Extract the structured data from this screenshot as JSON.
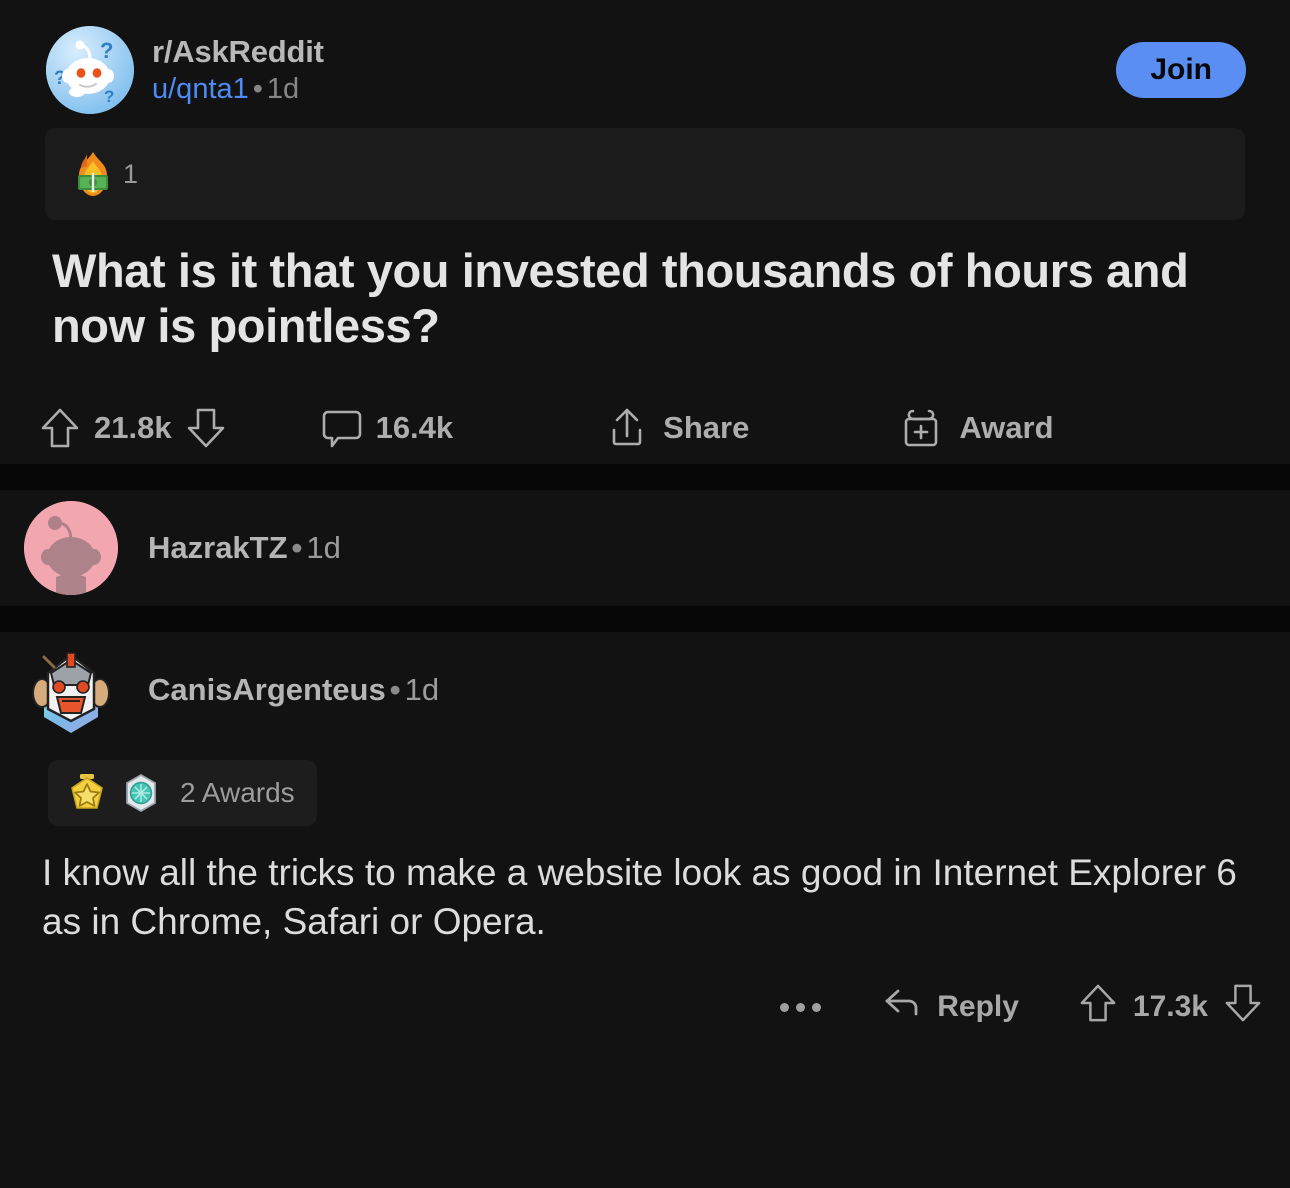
{
  "post": {
    "subreddit": "r/AskReddit",
    "author": "u/qnta1",
    "separator": "•",
    "age": "1d",
    "join_label": "Join",
    "award_icon": "burning-money-award-icon",
    "award_count": "1",
    "title": "What is it that you invested thousands of hours and now is pointless?",
    "actions": {
      "upvote_icon": "upvote-arrow-icon",
      "score": "21.8k",
      "downvote_icon": "downvote-arrow-icon",
      "comment_icon": "comment-bubble-icon",
      "comment_count": "16.4k",
      "share_icon": "share-icon",
      "share_label": "Share",
      "award_icon": "gift-award-icon",
      "award_label": "Award"
    }
  },
  "comments": [
    {
      "avatar_icon": "snoo-avatar-pink-icon",
      "author": "HazrakTZ",
      "separator": "•",
      "age": "1d"
    },
    {
      "avatar_icon": "mecha-avatar-icon",
      "author": "CanisArgenteus",
      "separator": "•",
      "age": "1d",
      "awards": {
        "badges": [
          "gold-star-badge-icon",
          "teal-gem-badge-icon"
        ],
        "label": "2 Awards"
      },
      "body": "I know all the tricks to make a website look as good in Internet Explorer 6 as in Chrome, Safari or Opera.",
      "footer": {
        "overflow_icon": "overflow-menu-icon",
        "reply_icon": "reply-arrow-icon",
        "reply_label": "Reply",
        "upvote_icon": "upvote-arrow-icon",
        "score": "17.3k",
        "downvote_icon": "downvote-arrow-icon"
      }
    }
  ],
  "colors": {
    "background": "#121212",
    "join_button": "#5a8ef2",
    "username_link": "#4e8cf5",
    "divider": "#070707",
    "award_bar": "#1b1b1b"
  }
}
